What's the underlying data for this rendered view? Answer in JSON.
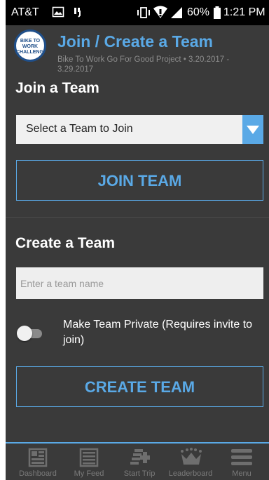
{
  "status_bar": {
    "carrier": "AT&T",
    "battery": "60%",
    "time": "1:21 PM"
  },
  "header": {
    "title": "Join / Create a Team",
    "subtitle": "Bike To Work Go For Good Project • 3.20.2017 - 3.29.2017",
    "logo_text": "BIKE TO WORK CHALLENGE"
  },
  "join": {
    "heading": "Join a Team",
    "select_value": "Select a Team to Join",
    "button_label": "JOIN TEAM"
  },
  "create": {
    "heading": "Create a Team",
    "input_placeholder": "Enter a team name",
    "input_value": "",
    "private_toggle_label": "Make Team Private (Requires invite to join)",
    "private_toggle_on": false,
    "button_label": "CREATE TEAM"
  },
  "nav": {
    "items": [
      {
        "label": "Dashboard",
        "icon": "dashboard-icon"
      },
      {
        "label": "My Feed",
        "icon": "feed-icon"
      },
      {
        "label": "Start Trip",
        "icon": "start-trip-icon"
      },
      {
        "label": "Leaderboard",
        "icon": "crown-icon"
      },
      {
        "label": "Menu",
        "icon": "menu-icon"
      }
    ]
  },
  "colors": {
    "accent": "#5aa9e6",
    "background": "#3a3a3a",
    "status_bar": "#000000"
  }
}
